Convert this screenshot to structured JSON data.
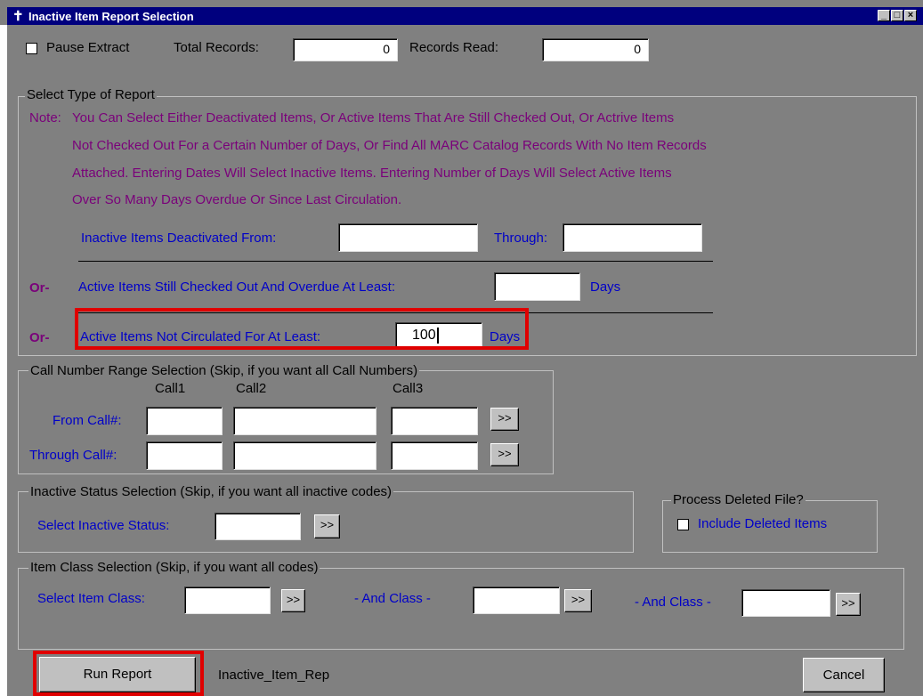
{
  "window": {
    "title": "Inactive Item Report Selection",
    "controls": [
      "_",
      "□",
      "×"
    ]
  },
  "top": {
    "pause_label": "Pause Extract",
    "total_records_label": "Total Records:",
    "total_records_value": "0",
    "records_read_label": "Records Read:",
    "records_read_value": "0"
  },
  "report_type": {
    "group_label": "Select Type of Report",
    "note_prefix": "Note:",
    "note_line1": "You Can Select Either Deactivated Items, Or Active Items That Are Still Checked Out, Or Actrive Items",
    "note_line2": "Not Checked Out For a Certain Number of Days, Or Find All MARC Catalog Records With No Item Records",
    "note_line3": "Attached.  Entering Dates Will Select Inactive Items.  Entering Number of Days Will Select Active Items",
    "note_line4": "Over So Many Days Overdue Or Since Last Circulation.",
    "deactivated_from_label": "Inactive Items Deactivated From:",
    "deactivated_from_value": "",
    "through_label": "Through:",
    "through_value": "",
    "or1": "Or-",
    "overdue_label": "Active Items Still Checked Out And Overdue At Least:",
    "overdue_value": "",
    "days1": "Days",
    "or2": "Or-",
    "not_circ_label": "Active Items Not Circulated For At Least:",
    "not_circ_value": "100",
    "days2": "Days"
  },
  "call_range": {
    "group_label": "Call Number Range Selection (Skip, if you want all Call Numbers)",
    "col1": "Call1",
    "col2": "Call2",
    "col3": "Call3",
    "from_label": "From Call#:",
    "through_label": "Through Call#:",
    "lookup": ">>"
  },
  "inactive_status": {
    "group_label": "Inactive Status Selection (Skip, if you want all inactive codes)",
    "select_label": "Select Inactive Status:",
    "lookup": ">>"
  },
  "deleted": {
    "group_label": "Process Deleted File?",
    "include_label": "Include Deleted Items"
  },
  "item_class": {
    "group_label": "Item Class Selection (Skip, if you want all codes)",
    "select_label": "Select Item Class:",
    "and1": "- And Class -",
    "and2": "- And Class -",
    "lookup": ">>"
  },
  "footer": {
    "run_label": "Run Report",
    "report_name": "Inactive_Item_Rep",
    "cancel_label": "Cancel"
  },
  "colors": {
    "highlight": "#e00000",
    "title_bar": "#00007e",
    "note_text": "#7a007a",
    "field_label": "#0000c8"
  }
}
